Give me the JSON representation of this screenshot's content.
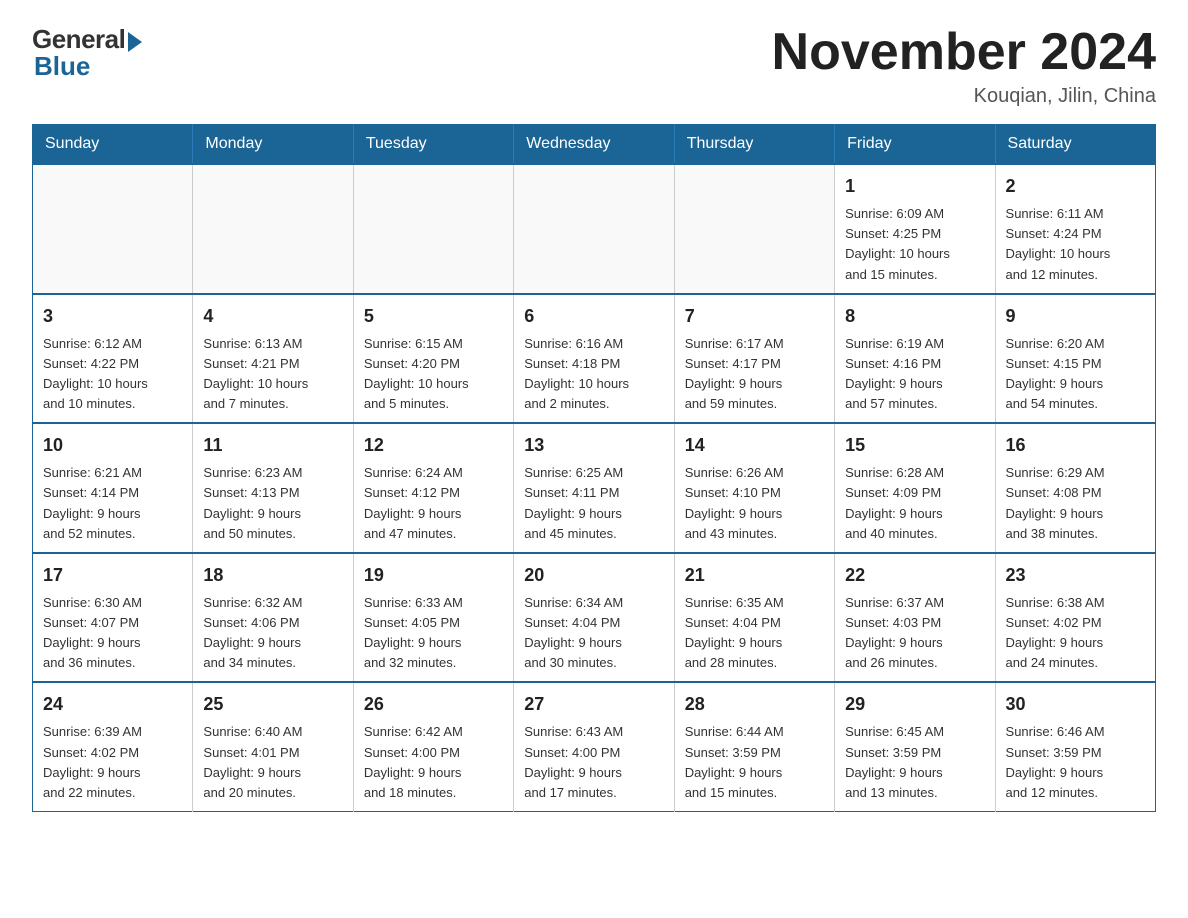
{
  "logo": {
    "general": "General",
    "blue": "Blue"
  },
  "title": "November 2024",
  "location": "Kouqian, Jilin, China",
  "weekdays": [
    "Sunday",
    "Monday",
    "Tuesday",
    "Wednesday",
    "Thursday",
    "Friday",
    "Saturday"
  ],
  "weeks": [
    [
      {
        "day": "",
        "info": ""
      },
      {
        "day": "",
        "info": ""
      },
      {
        "day": "",
        "info": ""
      },
      {
        "day": "",
        "info": ""
      },
      {
        "day": "",
        "info": ""
      },
      {
        "day": "1",
        "info": "Sunrise: 6:09 AM\nSunset: 4:25 PM\nDaylight: 10 hours\nand 15 minutes."
      },
      {
        "day": "2",
        "info": "Sunrise: 6:11 AM\nSunset: 4:24 PM\nDaylight: 10 hours\nand 12 minutes."
      }
    ],
    [
      {
        "day": "3",
        "info": "Sunrise: 6:12 AM\nSunset: 4:22 PM\nDaylight: 10 hours\nand 10 minutes."
      },
      {
        "day": "4",
        "info": "Sunrise: 6:13 AM\nSunset: 4:21 PM\nDaylight: 10 hours\nand 7 minutes."
      },
      {
        "day": "5",
        "info": "Sunrise: 6:15 AM\nSunset: 4:20 PM\nDaylight: 10 hours\nand 5 minutes."
      },
      {
        "day": "6",
        "info": "Sunrise: 6:16 AM\nSunset: 4:18 PM\nDaylight: 10 hours\nand 2 minutes."
      },
      {
        "day": "7",
        "info": "Sunrise: 6:17 AM\nSunset: 4:17 PM\nDaylight: 9 hours\nand 59 minutes."
      },
      {
        "day": "8",
        "info": "Sunrise: 6:19 AM\nSunset: 4:16 PM\nDaylight: 9 hours\nand 57 minutes."
      },
      {
        "day": "9",
        "info": "Sunrise: 6:20 AM\nSunset: 4:15 PM\nDaylight: 9 hours\nand 54 minutes."
      }
    ],
    [
      {
        "day": "10",
        "info": "Sunrise: 6:21 AM\nSunset: 4:14 PM\nDaylight: 9 hours\nand 52 minutes."
      },
      {
        "day": "11",
        "info": "Sunrise: 6:23 AM\nSunset: 4:13 PM\nDaylight: 9 hours\nand 50 minutes."
      },
      {
        "day": "12",
        "info": "Sunrise: 6:24 AM\nSunset: 4:12 PM\nDaylight: 9 hours\nand 47 minutes."
      },
      {
        "day": "13",
        "info": "Sunrise: 6:25 AM\nSunset: 4:11 PM\nDaylight: 9 hours\nand 45 minutes."
      },
      {
        "day": "14",
        "info": "Sunrise: 6:26 AM\nSunset: 4:10 PM\nDaylight: 9 hours\nand 43 minutes."
      },
      {
        "day": "15",
        "info": "Sunrise: 6:28 AM\nSunset: 4:09 PM\nDaylight: 9 hours\nand 40 minutes."
      },
      {
        "day": "16",
        "info": "Sunrise: 6:29 AM\nSunset: 4:08 PM\nDaylight: 9 hours\nand 38 minutes."
      }
    ],
    [
      {
        "day": "17",
        "info": "Sunrise: 6:30 AM\nSunset: 4:07 PM\nDaylight: 9 hours\nand 36 minutes."
      },
      {
        "day": "18",
        "info": "Sunrise: 6:32 AM\nSunset: 4:06 PM\nDaylight: 9 hours\nand 34 minutes."
      },
      {
        "day": "19",
        "info": "Sunrise: 6:33 AM\nSunset: 4:05 PM\nDaylight: 9 hours\nand 32 minutes."
      },
      {
        "day": "20",
        "info": "Sunrise: 6:34 AM\nSunset: 4:04 PM\nDaylight: 9 hours\nand 30 minutes."
      },
      {
        "day": "21",
        "info": "Sunrise: 6:35 AM\nSunset: 4:04 PM\nDaylight: 9 hours\nand 28 minutes."
      },
      {
        "day": "22",
        "info": "Sunrise: 6:37 AM\nSunset: 4:03 PM\nDaylight: 9 hours\nand 26 minutes."
      },
      {
        "day": "23",
        "info": "Sunrise: 6:38 AM\nSunset: 4:02 PM\nDaylight: 9 hours\nand 24 minutes."
      }
    ],
    [
      {
        "day": "24",
        "info": "Sunrise: 6:39 AM\nSunset: 4:02 PM\nDaylight: 9 hours\nand 22 minutes."
      },
      {
        "day": "25",
        "info": "Sunrise: 6:40 AM\nSunset: 4:01 PM\nDaylight: 9 hours\nand 20 minutes."
      },
      {
        "day": "26",
        "info": "Sunrise: 6:42 AM\nSunset: 4:00 PM\nDaylight: 9 hours\nand 18 minutes."
      },
      {
        "day": "27",
        "info": "Sunrise: 6:43 AM\nSunset: 4:00 PM\nDaylight: 9 hours\nand 17 minutes."
      },
      {
        "day": "28",
        "info": "Sunrise: 6:44 AM\nSunset: 3:59 PM\nDaylight: 9 hours\nand 15 minutes."
      },
      {
        "day": "29",
        "info": "Sunrise: 6:45 AM\nSunset: 3:59 PM\nDaylight: 9 hours\nand 13 minutes."
      },
      {
        "day": "30",
        "info": "Sunrise: 6:46 AM\nSunset: 3:59 PM\nDaylight: 9 hours\nand 12 minutes."
      }
    ]
  ]
}
